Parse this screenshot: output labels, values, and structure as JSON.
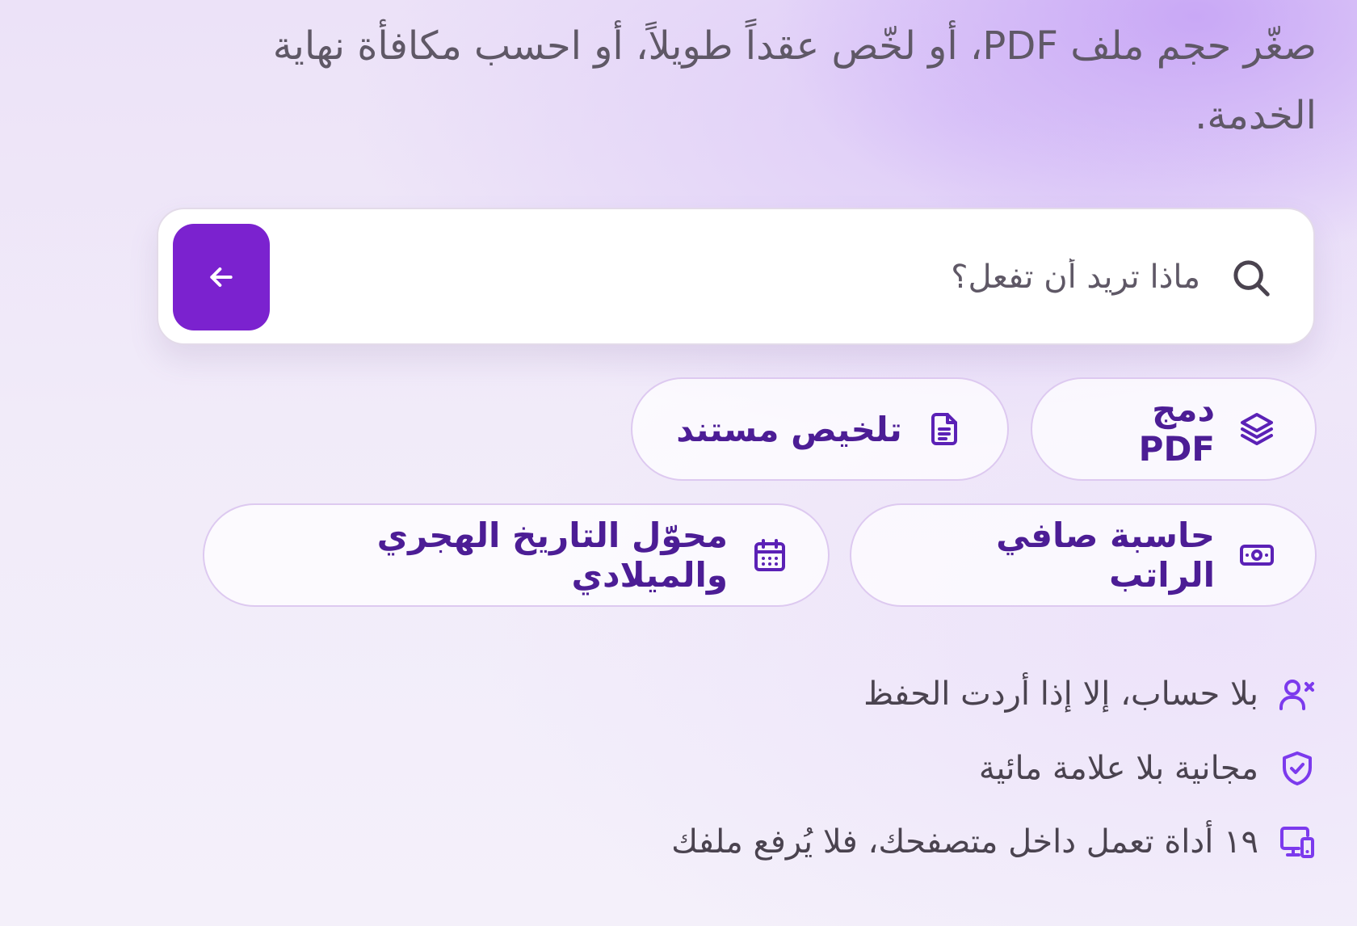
{
  "hero": {
    "subtitle": "صغّر حجم ملف PDF، أو لخّص عقداً طويلاً، أو احسب مكافأة نهاية الخدمة."
  },
  "search": {
    "placeholder": "ماذا تريد أن تفعل؟",
    "value": "",
    "icon": "search-icon",
    "submit_icon": "arrow-left-icon",
    "submit_color": "#7b22cf"
  },
  "quick_actions": [
    {
      "label": "دمج PDF",
      "icon": "layers-icon"
    },
    {
      "label": "تلخيص مستند",
      "icon": "document-text-icon"
    },
    {
      "label": "حاسبة صافي الراتب",
      "icon": "cash-icon"
    },
    {
      "label": "محوّل التاريخ الهجري والميلادي",
      "icon": "calendar-icon"
    }
  ],
  "features": [
    {
      "text": "بلا حساب، إلا إذا أردت الحفظ",
      "icon": "user-x-icon"
    },
    {
      "text": "مجانية بلا علامة مائية",
      "icon": "shield-check-icon"
    },
    {
      "text": "١٩ أداة تعمل داخل متصفحك، فلا يُرفع ملفك",
      "icon": "devices-icon"
    }
  ],
  "colors": {
    "accent": "#7b22cf",
    "chip_text": "#4c1d95",
    "chip_border": "#ddc9f0",
    "body_text": "#5f5866",
    "feature_icon": "#7c3aed"
  }
}
